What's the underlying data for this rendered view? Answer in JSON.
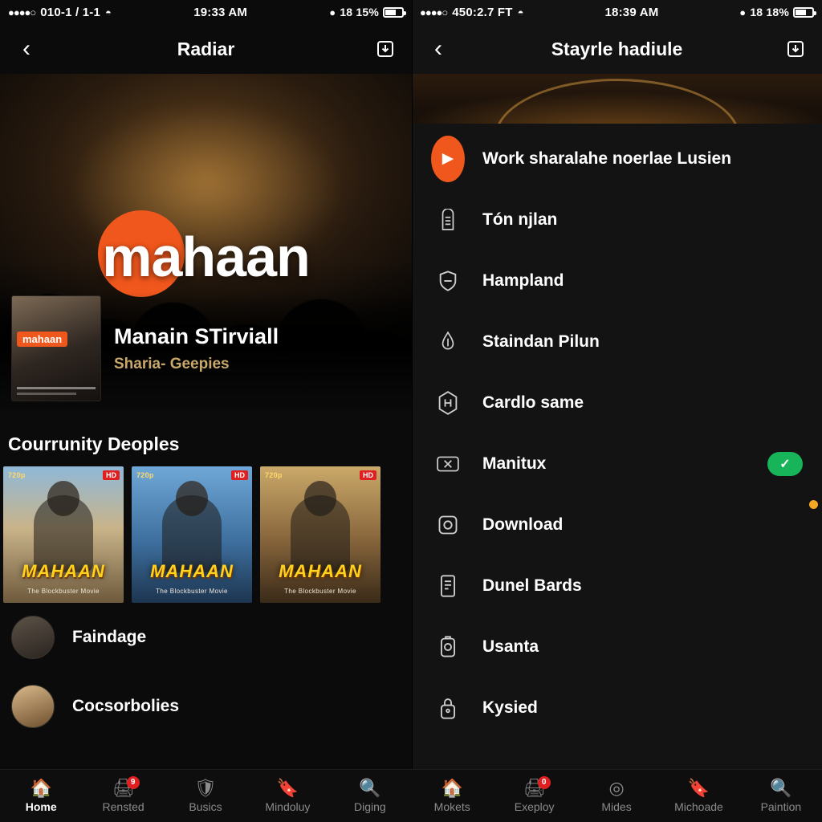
{
  "left": {
    "status": {
      "signal_dots": "●●●●○",
      "carrier": "010-1 / 1-1",
      "wifi_icon": "wifi-icon",
      "time": "19:33 AM",
      "drop_icon": "drop-icon",
      "battery_text": "18 15%",
      "battery_icon": "battery-icon"
    },
    "header": {
      "back_icon": "chevron-left-icon",
      "title": "Radiar",
      "download_icon": "download-icon"
    },
    "hero": {
      "logo_text": "mahaan",
      "logo_accent": "#f0571c"
    },
    "title_block": {
      "poster_badge": "mahaan",
      "title": "Manain STirviall",
      "subtitle": "Sharia- Geepies",
      "subtitle_color": "#c9a96a"
    },
    "section": {
      "title": "Courrunity Deoples",
      "cards": [
        {
          "badge": "HD",
          "top_text": "720p",
          "title": "MAHAAN",
          "sub": "The Blockbuster Movie"
        },
        {
          "badge": "HD",
          "top_text": "720p",
          "title": "MAHAAN",
          "sub": "The Blockbuster Movie"
        },
        {
          "badge": "HD",
          "top_text": "720p",
          "title": "MAHAAN",
          "sub": "The Blockbuster Movie"
        }
      ]
    },
    "list": [
      {
        "avatar": "avatar",
        "label": "Faindage"
      },
      {
        "avatar": "avatar",
        "label": "Cocsorbolies"
      }
    ]
  },
  "right": {
    "status": {
      "signal_dots": "●●●●○",
      "carrier": "450:2.7 FT",
      "wifi_icon": "wifi-icon",
      "time": "18:39 AM",
      "drop_icon": "drop-icon",
      "battery_text": "18 18%",
      "battery_icon": "battery-icon"
    },
    "header": {
      "back_icon": "chevron-left-icon",
      "title": "Stayrle hadiule",
      "download_icon": "download-icon"
    },
    "menu": [
      {
        "icon": "play-circle-icon",
        "label": "Work sharalahe noerlae Lusien",
        "accessory": ""
      },
      {
        "icon": "building-icon",
        "label": "Tón njlan",
        "accessory": ""
      },
      {
        "icon": "shield-icon",
        "label": "Hampland",
        "accessory": ""
      },
      {
        "icon": "thermometer-icon",
        "label": "Staindan Pilun",
        "accessory": ""
      },
      {
        "icon": "hexagon-h-icon",
        "label": "Cardlo same",
        "accessory": ""
      },
      {
        "icon": "ticket-icon",
        "label": "Manitux",
        "accessory": "check-toggle"
      },
      {
        "icon": "download-box-icon",
        "label": "Download",
        "accessory": "dot-badge"
      },
      {
        "icon": "document-icon",
        "label": "Dunel Bards",
        "accessory": ""
      },
      {
        "icon": "battery-box-icon",
        "label": "Usanta",
        "accessory": ""
      },
      {
        "icon": "lock-icon",
        "label": "Kysied",
        "accessory": ""
      }
    ]
  },
  "tabbar": [
    {
      "icon": "home-icon",
      "label": "Home",
      "active": true,
      "badge": ""
    },
    {
      "icon": "printer-icon",
      "label": "Rensted",
      "active": false,
      "badge": "9"
    },
    {
      "icon": "shield-icon",
      "label": "Busics",
      "active": false,
      "badge": ""
    },
    {
      "icon": "bookmark-icon",
      "label": "Mindoluy",
      "active": false,
      "badge": ""
    },
    {
      "icon": "search-icon",
      "label": "Diging",
      "active": false,
      "badge": ""
    },
    {
      "icon": "home-icon",
      "label": "Mokets",
      "active": false,
      "badge": ""
    },
    {
      "icon": "printer-icon",
      "label": "Exeploy",
      "active": false,
      "badge": "0"
    },
    {
      "icon": "compass-icon",
      "label": "Mides",
      "active": false,
      "badge": ""
    },
    {
      "icon": "bookmark-icon",
      "label": "Michoade",
      "active": false,
      "badge": ""
    },
    {
      "icon": "search-icon",
      "label": "Paintion",
      "active": false,
      "badge": ""
    }
  ]
}
